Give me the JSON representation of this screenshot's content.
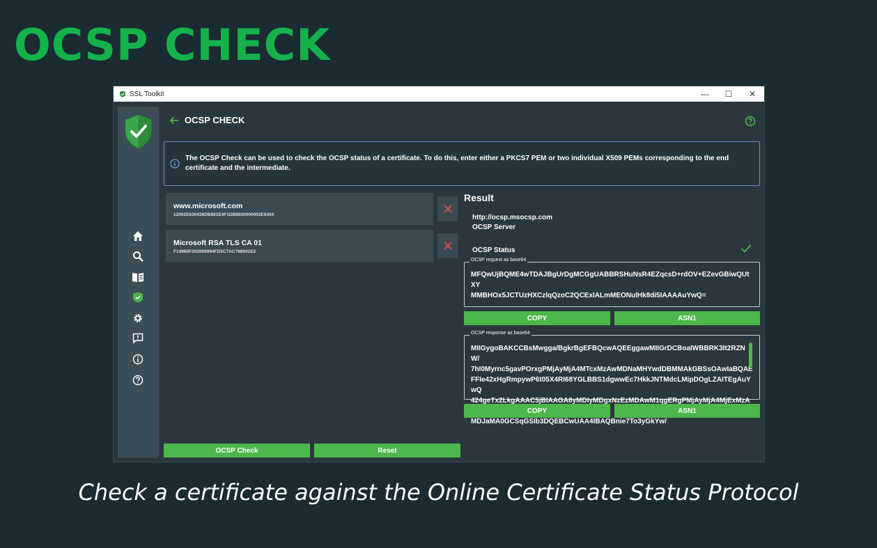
{
  "hero_title": "OCSP CHECK",
  "caption": "Check a certificate against the Online Certificate Status Protocol",
  "window": {
    "title": "SSL Toolkit",
    "controls": {
      "minimize": "—",
      "maximize": "☐",
      "close": "✕"
    }
  },
  "sidebar": {
    "logo": "shield-check-icon",
    "items": [
      {
        "icon": "home-icon"
      },
      {
        "icon": "search-icon"
      },
      {
        "icon": "book-icon"
      },
      {
        "icon": "shield-icon",
        "active": true
      },
      {
        "icon": "gear-icon"
      },
      {
        "icon": "feedback-icon"
      },
      {
        "icon": "info-icon"
      },
      {
        "icon": "help-icon"
      }
    ]
  },
  "header": {
    "title": "OCSP CHECK"
  },
  "info_message": "The OCSP Check can be used to check the OCSP status of a certificate. To do this, enter either a PKCS7 PEM or two individual X509 PEMs corresponding to the end certificate and the intermediate.",
  "certificates": [
    {
      "name": "www.microsoft.com",
      "serial": "12002E630438DB881E4F1DB8920000002E6304"
    },
    {
      "name": "Microsoft RSA TLS CA 01",
      "serial": "F14965F202069994FD5C7AC788941E2"
    }
  ],
  "result": {
    "title": "Result",
    "ocsp_url": "http://ocsp.msocsp.com",
    "ocsp_server_label": "OCSP Server",
    "ocsp_status_label": "OCSP Status",
    "request": {
      "legend": "OCSP request as base64",
      "value": "MFQwUjBQME4wTDAJBgUrDgMCGgUABBRSHuNsR4EZqcsD+rdOV+EZevGBiwQUtXY\nMMBHOx5JCTUzHXCzlqQzoC2QCExlALmMEONulHk8di5IAAAAuYwQ="
    },
    "response": {
      "legend": "OCSP response as base64",
      "value": "MIIGygoBAKCCBsMwgga/BgkrBgEFBQcwAQEEggawMIIGrDCBoaIWBBRK3lt2RZNW/\n7hI0Myrnc5gavPOrxgPMjAyMjA4MTcxMzAwMDNaMHYwdDBMMAkGBSsOAwIaBQAE\nFFIe42xHgRmpywP6t05X4RI68YGLBBS1dgwwEc7HkkJNTMdcLMipDOgLZAITEgAuYwQ\n424geTx2LkgAAAC5jBIAAGA8yMDIyMDgxNzEzMDAwM1qgERgPMjAyMjA4MjExMzAw\nMDJaMA0GCSqGSIb3DQEBCwUAA4IBAQBnie7To3yGkYw/"
    },
    "copy_label": "COPY",
    "asn1_label": "ASN1"
  },
  "buttons": {
    "check": "OCSP Check",
    "reset": "Reset"
  },
  "colors": {
    "accent": "#4cb84c",
    "hero": "#14b24a",
    "background": "#1a2b32",
    "panel": "#2b373e"
  }
}
